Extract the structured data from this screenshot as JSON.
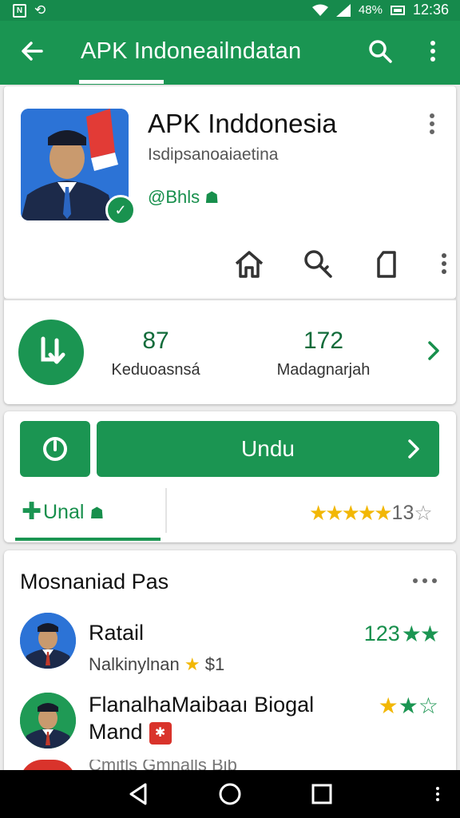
{
  "status_bar": {
    "left_icon_label": "N",
    "right_signal": "48%",
    "time": "12:36"
  },
  "app_bar": {
    "title": "APK Indoneailndatan"
  },
  "app_header": {
    "name": "APK Inddonesia",
    "subtitle": "Isdipsanoaiaetina",
    "developer": "@Bhls"
  },
  "stats": [
    {
      "value": "87",
      "label": "Keduoasnsá"
    },
    {
      "value": "172",
      "label": "Madagnarjah"
    }
  ],
  "install": {
    "button_label": "Undu",
    "tab_label": "Unal",
    "rating_text": "13"
  },
  "list": {
    "title": "Mosnaniad Pas",
    "items": [
      {
        "name": "Ratail",
        "meta": "Nalkinylnan",
        "meta_suffix": "$1",
        "rating": "123"
      },
      {
        "name": "FlanalhaMaibaaı Biogal",
        "name2": "Mand",
        "rating": ""
      }
    ],
    "partial_text": "Cmitls Gmnalls Bib"
  },
  "colors": {
    "primary": "#1a9552",
    "primary_dark": "#168a4c",
    "star_yellow": "#f2b705",
    "badge_red": "#d9332b"
  }
}
